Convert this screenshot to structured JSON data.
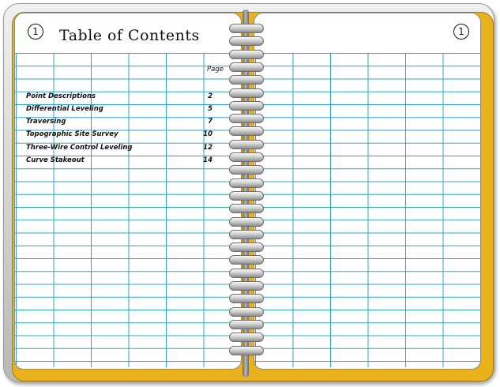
{
  "left_page": {
    "page_number": "1",
    "title": "Table of Contents",
    "page_column_header": "Page",
    "entries": [
      {
        "label": "Point Descriptions",
        "page": "2"
      },
      {
        "label": "Differential Leveling",
        "page": "5"
      },
      {
        "label": "Traversing",
        "page": "7"
      },
      {
        "label": "Topographic Site Survey",
        "page": "10"
      },
      {
        "label": "Three-Wire Control Leveling",
        "page": "12"
      },
      {
        "label": "Curve Stakeout",
        "page": "14"
      }
    ]
  },
  "right_page": {
    "page_number": "1"
  },
  "colors": {
    "cover_gold": "#e9b21a",
    "grid_line": "#2aa5c8",
    "cover_silver": "#c8c8c8"
  }
}
